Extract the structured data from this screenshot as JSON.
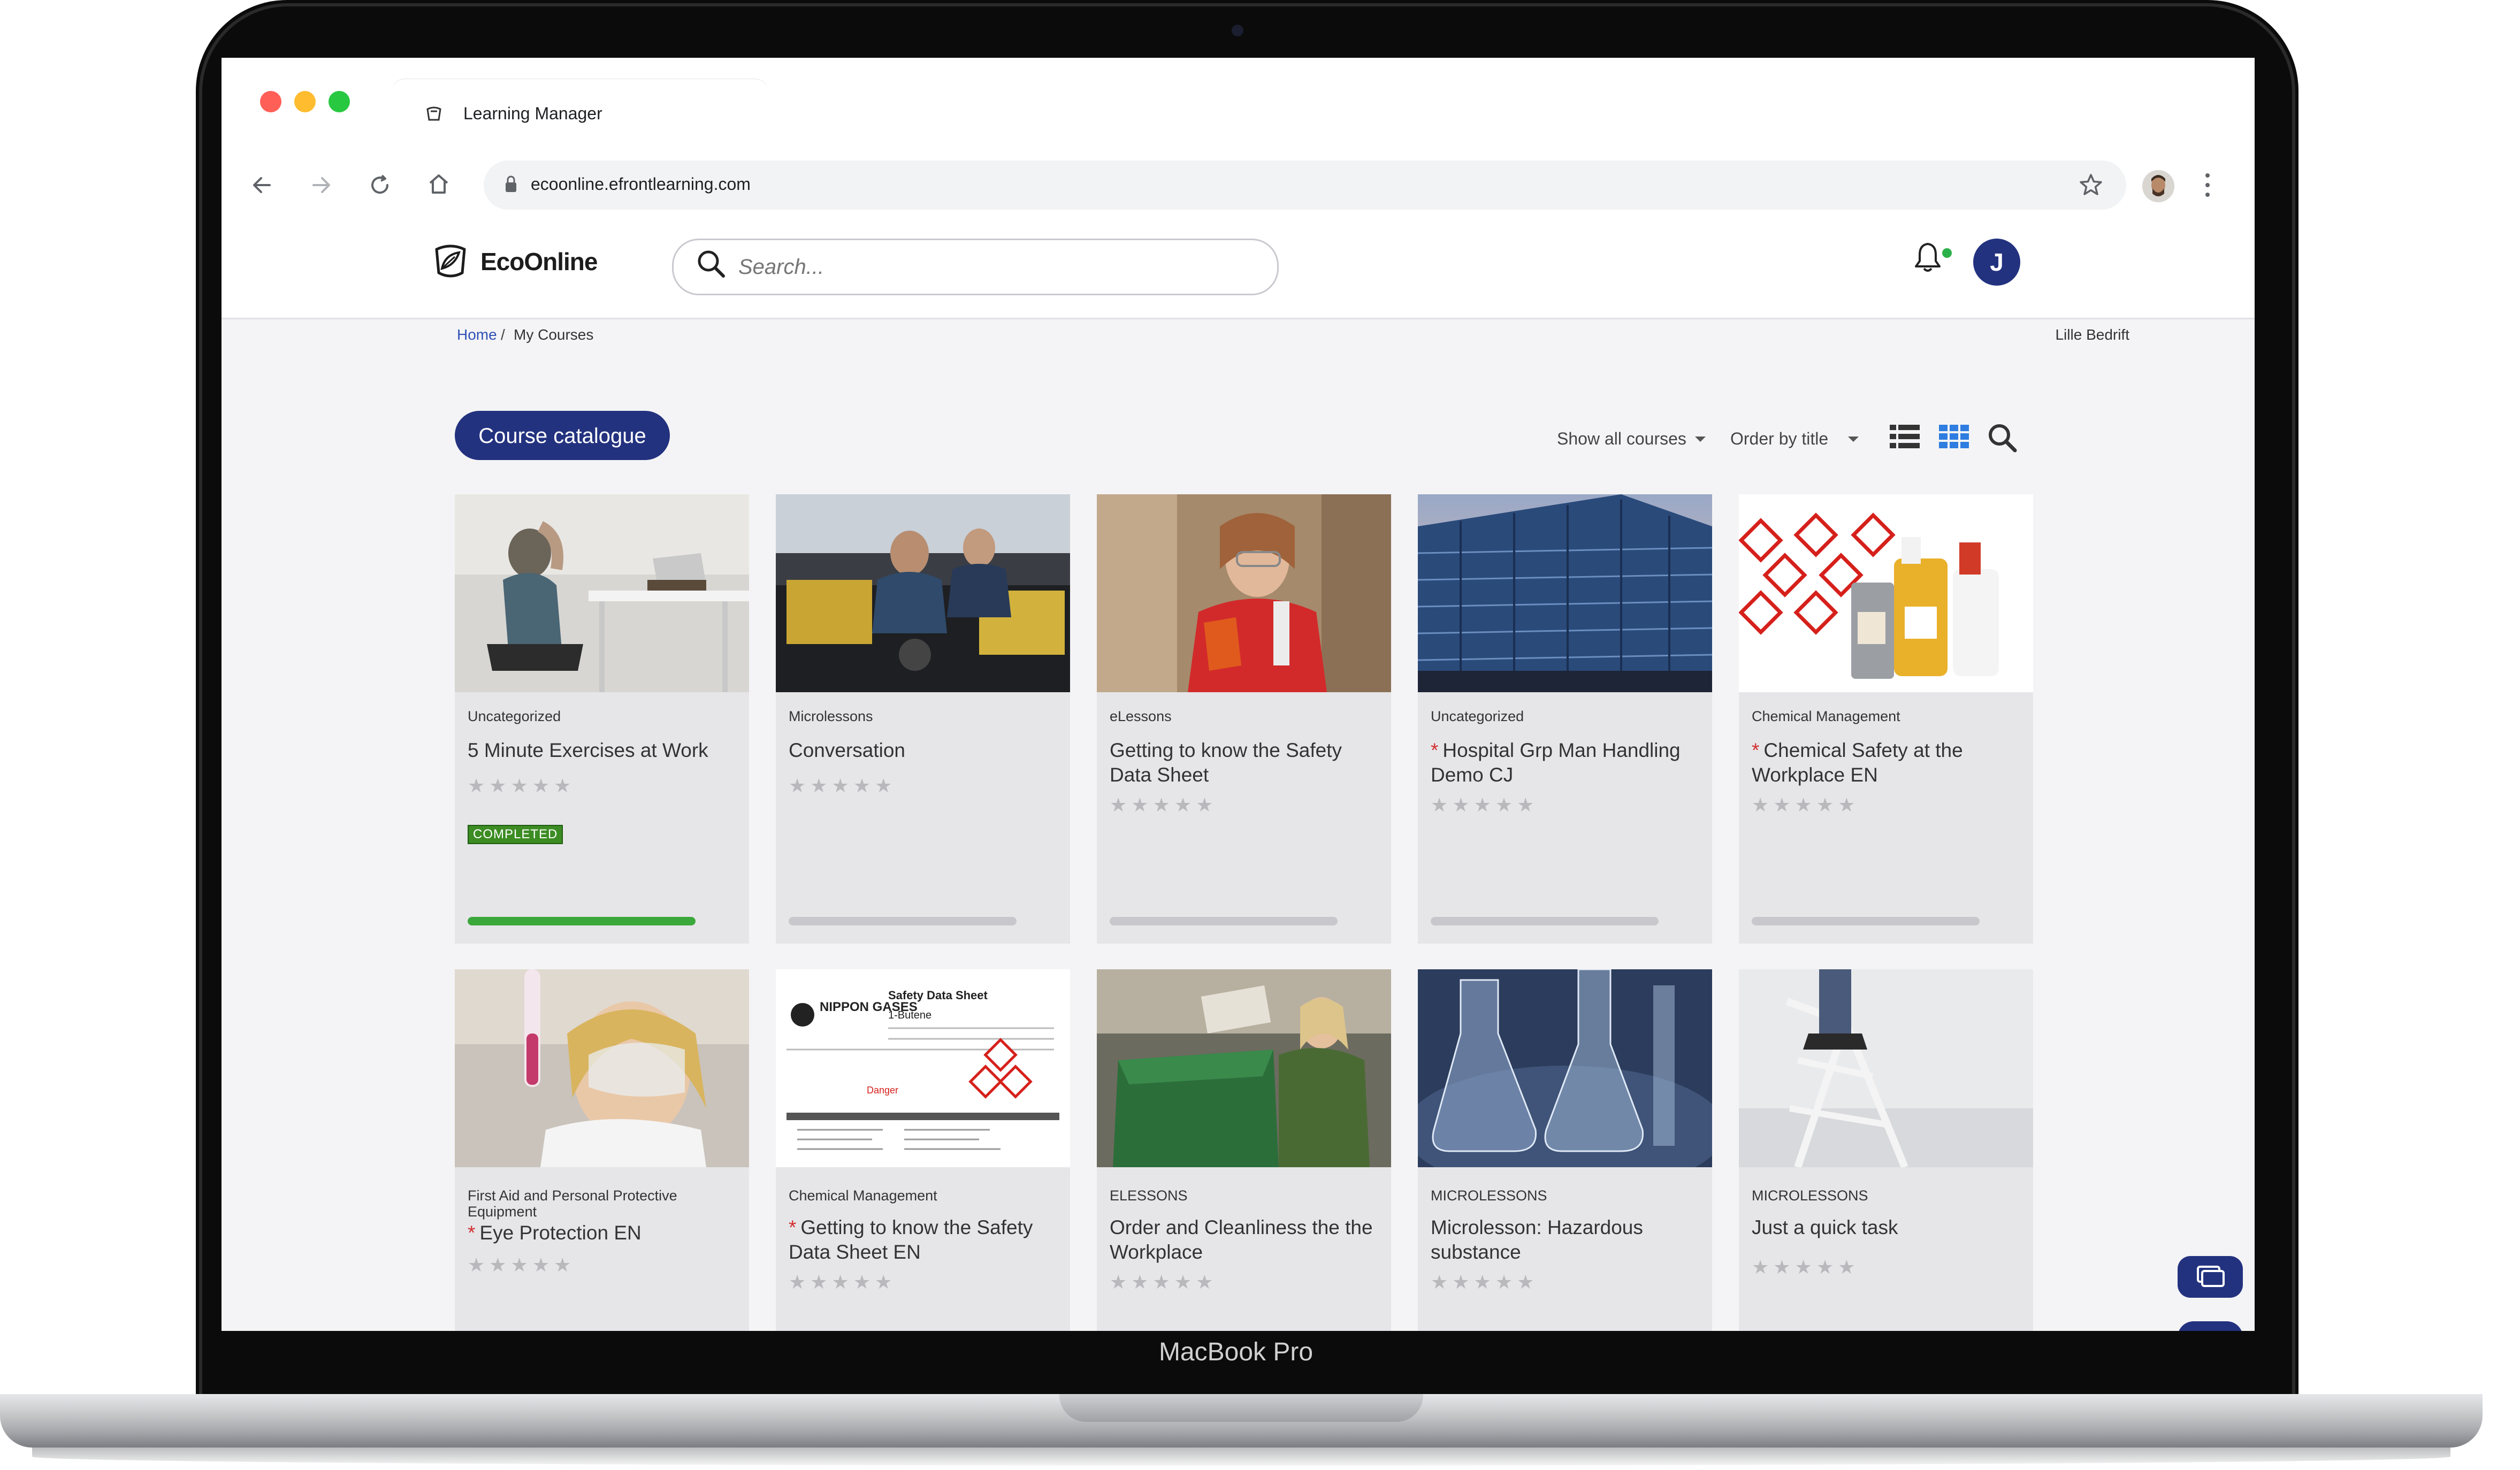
{
  "device": {
    "label": "MacBook Pro"
  },
  "browser": {
    "tab_title": "Learning Manager",
    "url": "ecoonline.efrontlearning.com",
    "traffic_lights": [
      "#ff5f57",
      "#febc2e",
      "#28c840"
    ]
  },
  "app": {
    "logo": "EcoOnline",
    "search_placeholder": "Search...",
    "avatar_initial": "J",
    "accent": "#23327f"
  },
  "breadcrumb": {
    "home": "Home",
    "separator": "/",
    "current": "My Courses"
  },
  "org_name": "Lille Bedrift",
  "controls": {
    "catalogue_button": "Course catalogue",
    "show_filter": "Show all courses",
    "order_filter": "Order by title"
  },
  "courses": [
    {
      "category": "Uncategorized",
      "title": "5 Minute Exercises at Work",
      "required": false,
      "rating": 0,
      "status": "COMPLETED",
      "progress": 1.0
    },
    {
      "category": "Microlessons",
      "title": "Conversation",
      "required": false,
      "rating": 0,
      "status": "",
      "progress": 0
    },
    {
      "category": "eLessons",
      "title": "Getting to know the Safety Data Sheet",
      "required": false,
      "rating": 0,
      "status": "",
      "progress": 0
    },
    {
      "category": "Uncategorized",
      "title": "Hospital Grp Man Handling Demo CJ",
      "required": true,
      "rating": 0,
      "status": "",
      "progress": 0
    },
    {
      "category": "Chemical Management",
      "title": "Chemical Safety at the Workplace EN",
      "required": true,
      "rating": 0,
      "status": "",
      "progress": 0
    },
    {
      "category": "First Aid and Personal Protective Equipment",
      "title": "Eye Protection EN",
      "required": true,
      "rating": 0,
      "status": "",
      "progress": null
    },
    {
      "category": "Chemical Management",
      "title": "Getting to know the Safety Data Sheet EN",
      "required": true,
      "rating": 0,
      "status": "",
      "progress": null
    },
    {
      "category": "ELESSONS",
      "title": "Order and Cleanliness the the Workplace",
      "required": false,
      "rating": 0,
      "status": "",
      "progress": null
    },
    {
      "category": "MICROLESSONS",
      "title": "Microlesson: Hazardous substance",
      "required": false,
      "rating": 0,
      "status": "",
      "progress": null
    },
    {
      "category": "MICROLESSONS",
      "title": "Just a quick task",
      "required": false,
      "rating": 0,
      "status": "",
      "progress": null
    }
  ],
  "thumb_labels": {
    "sds_brand": "NIPPON GASES",
    "sds_title": "Safety Data Sheet",
    "sds_substance": "1-Butene",
    "sds_danger": "Danger"
  }
}
